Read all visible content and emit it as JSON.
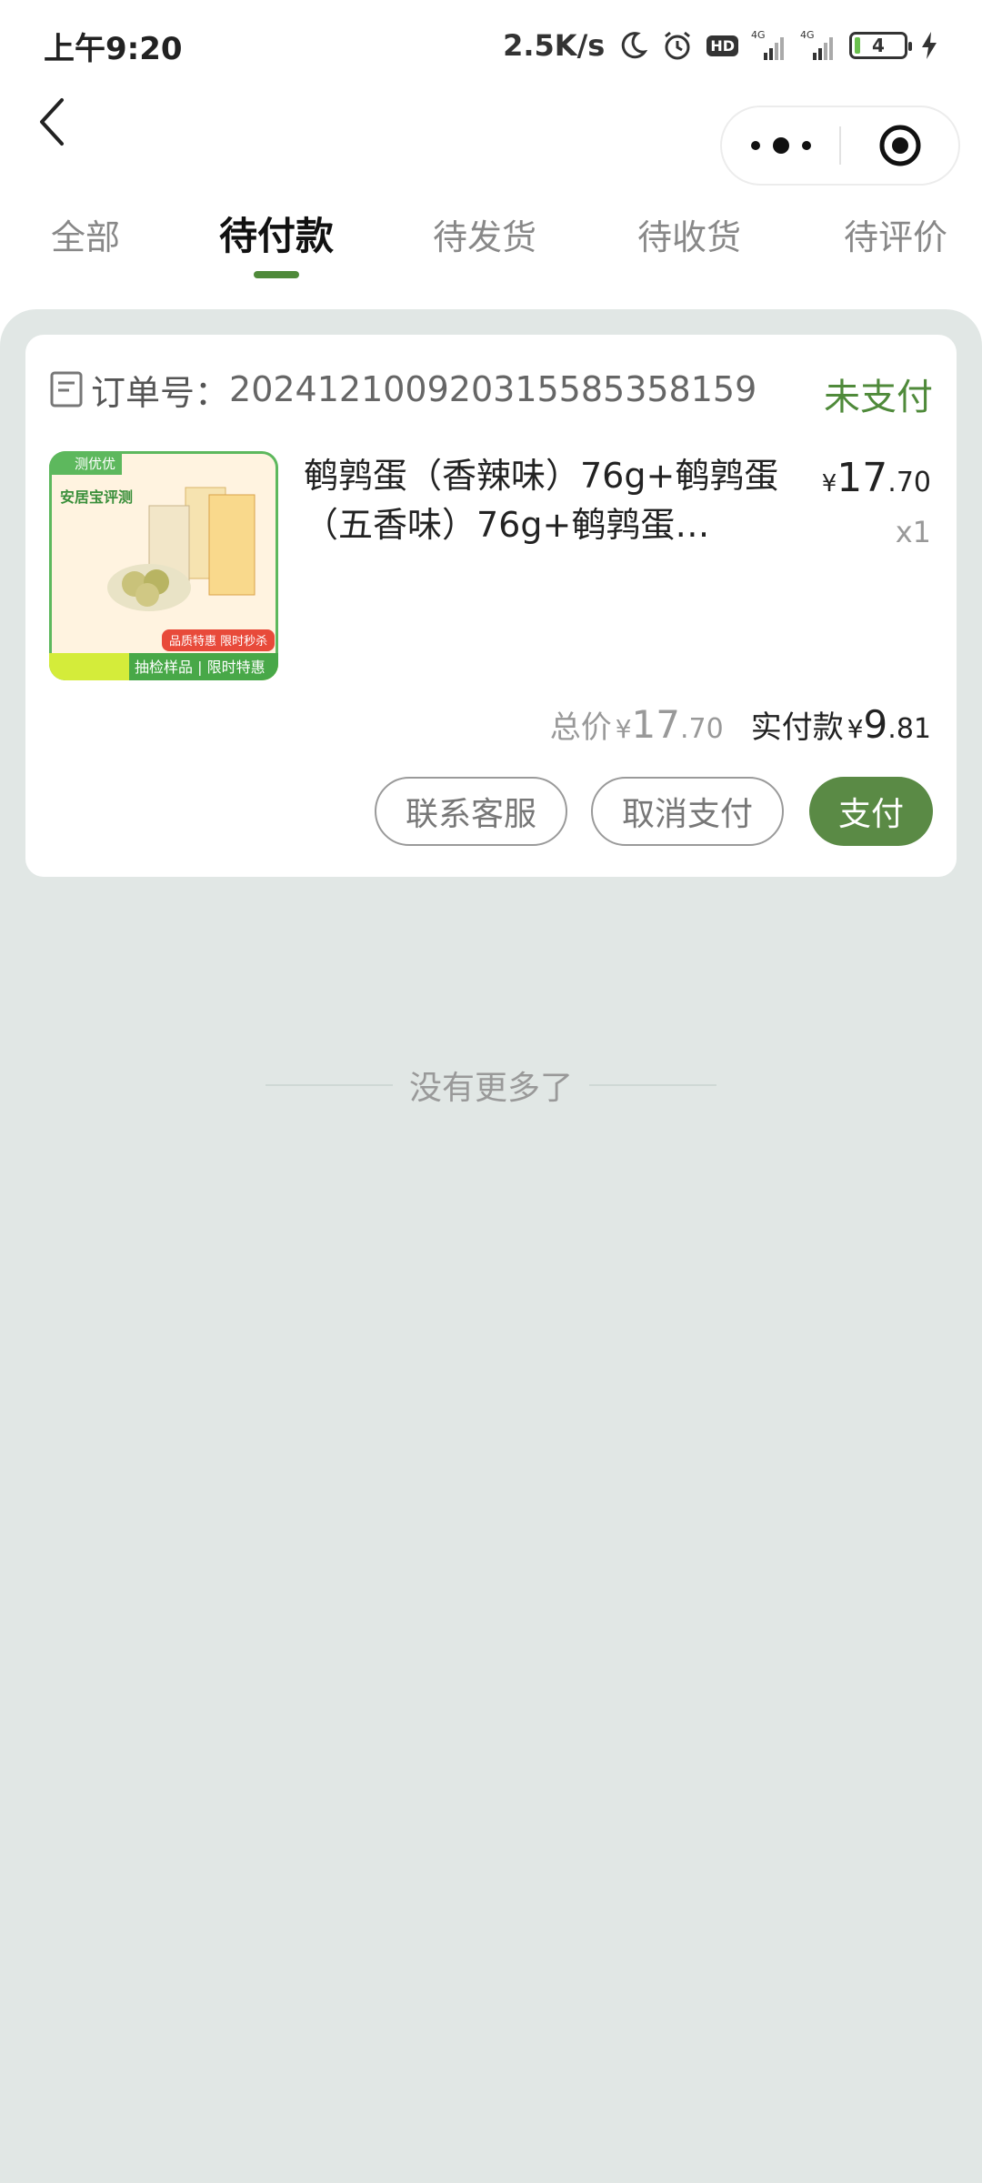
{
  "status_bar": {
    "time": "上午9:20",
    "net_speed": "2.5K/s",
    "hd": "HD",
    "signal1_label": "4G",
    "signal2_label": "4G",
    "battery": "4",
    "icons": [
      "moon-icon",
      "alarm-icon",
      "hd-icon",
      "signal-icon",
      "signal-icon",
      "battery-icon",
      "charging-icon"
    ]
  },
  "nav": {
    "back_icon": "chevron-left-icon",
    "capsule_icons": [
      "more-dots-icon",
      "target-icon"
    ]
  },
  "tabs": [
    {
      "label": "全部",
      "active": false
    },
    {
      "label": "待付款",
      "active": true
    },
    {
      "label": "待发货",
      "active": false
    },
    {
      "label": "待收货",
      "active": false
    },
    {
      "label": "待评价",
      "active": false
    }
  ],
  "order": {
    "order_no_label": "订单号：",
    "order_no": "20241210092031558535815​9",
    "status": "未支付",
    "product": {
      "title": "鹌鹑蛋（香辣味）76g+鹌鹑蛋（五香味）76g+鹌鹑蛋…",
      "image_text": {
        "badge": "测优优",
        "headline": "安居宝评测",
        "bottom": "抽检样品 | 限时特惠",
        "promo": "品质特惠 限时秒杀"
      },
      "price_symbol": "¥",
      "price_int": "17",
      "price_dec": ".70",
      "qty": "x1"
    },
    "total_label": "总价",
    "total_symbol": "¥",
    "total_int": "17",
    "total_dec": ".70",
    "paid_label": "实付款",
    "paid_symbol": "¥",
    "paid_int": "9",
    "paid_dec": ".81",
    "buttons": {
      "contact": "联系客服",
      "cancel": "取消支付",
      "pay": "支付"
    }
  },
  "footer": {
    "no_more": "没有更多了"
  },
  "colors": {
    "accent": "#4f8a3a",
    "pay_button": "#5a8a45",
    "background": "#e1e7e5"
  }
}
